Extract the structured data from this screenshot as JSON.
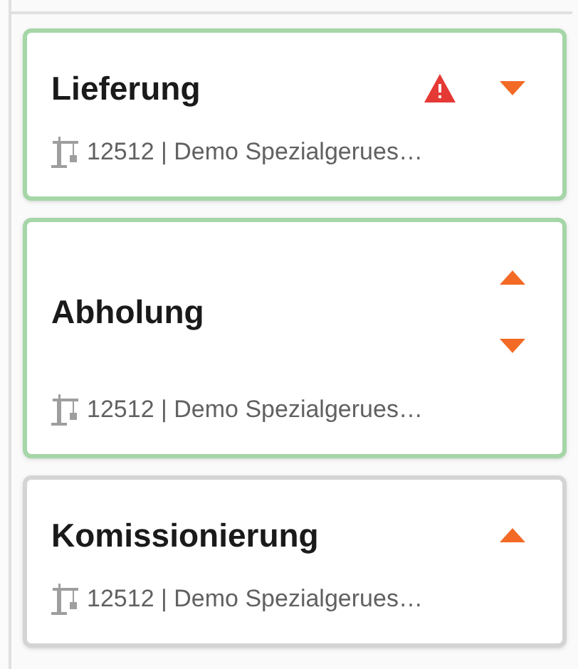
{
  "cards": [
    {
      "title": "Lieferung",
      "subtitle": "12512 | Demo Spezialgerues…",
      "color": "#a5d6a7",
      "warning": true,
      "can_move_up": false,
      "can_move_down": true
    },
    {
      "title": "Abholung",
      "subtitle": "12512 | Demo Spezialgerues…",
      "color": "#a5d6a7",
      "warning": false,
      "can_move_up": true,
      "can_move_down": true
    },
    {
      "title": "Komissionierung",
      "subtitle": "12512 | Demo Spezialgerues…",
      "color": "#d4d4d4",
      "warning": false,
      "can_move_up": true,
      "can_move_down": false
    }
  ]
}
